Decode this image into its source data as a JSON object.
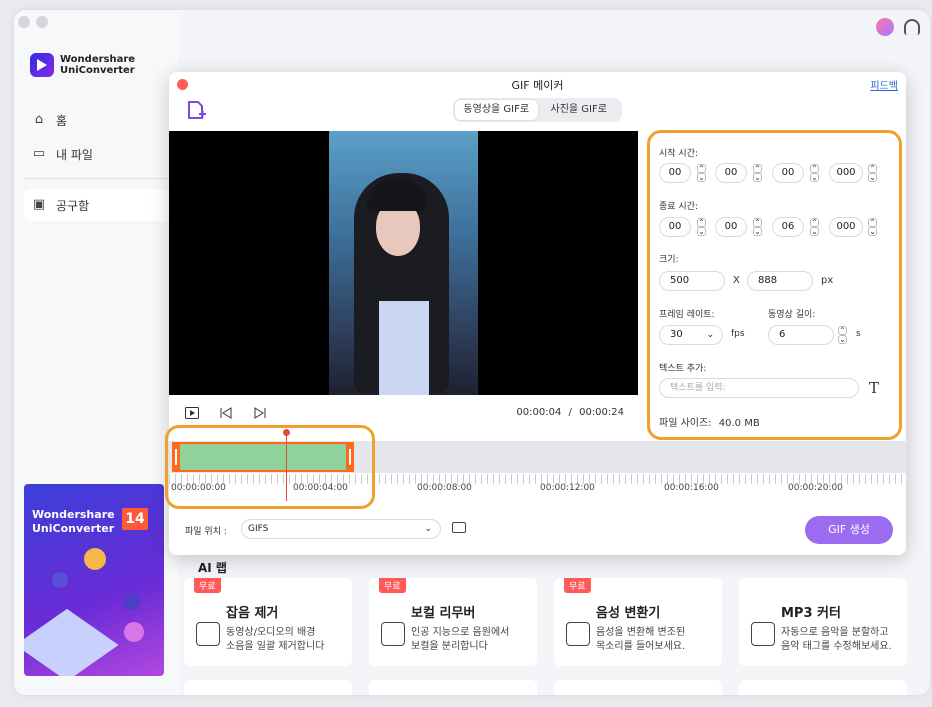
{
  "app": {
    "brand_line1": "Wondershare",
    "brand_line2": "UniConverter"
  },
  "sidebar": {
    "items": [
      {
        "label": "홈",
        "icon": "home-icon"
      },
      {
        "label": "내 파일",
        "icon": "folder-icon"
      },
      {
        "label": "공구함",
        "icon": "toolbox-icon"
      }
    ],
    "promo": {
      "title_line1": "Wondershare",
      "title_line2": "UniConverter",
      "badge": "14"
    }
  },
  "background": {
    "section_label": "AI 랩",
    "cards": [
      {
        "tag": "무료",
        "title": "잡음 제거",
        "desc1": "동영상/오디오의 배경",
        "desc2": "소음을 일괄 제거합니다"
      },
      {
        "tag": "무료",
        "title": "보컬 리무버",
        "desc1": "인공 지능으로 음원에서",
        "desc2": "보컬을 분리합니다"
      },
      {
        "tag": "무료",
        "title": "음성 변환기",
        "desc1": "음성을 변환해 변조된",
        "desc2": "목소리를 들어보세요."
      },
      {
        "tag": "",
        "title": "MP3 커터",
        "desc1": "자동으로 음악을 분할하고",
        "desc2": "음악 태그를 수정해보세요."
      }
    ]
  },
  "modal": {
    "title": "GIF 메이커",
    "feedback": "피드백",
    "tabs": [
      {
        "label": "동영상을 GIF로",
        "active": true
      },
      {
        "label": "사진을 GIF로",
        "active": false
      }
    ],
    "player": {
      "current": "00:00:04",
      "separator": "/",
      "total": "00:00:24"
    },
    "settings": {
      "start_label": "시작 시간:",
      "start": [
        "00",
        "00",
        "00",
        "000"
      ],
      "end_label": "종료 시간:",
      "end": [
        "00",
        "00",
        "06",
        "000"
      ],
      "size_label": "크기:",
      "width": "500",
      "x": "X",
      "height": "888",
      "px": "px",
      "framerate_label": "프레임 레이트:",
      "framerate": "30",
      "fps": "fps",
      "duration_label": "동영상 길이:",
      "duration": "6",
      "s": "s",
      "text_label": "텍스트 추가:",
      "text_placeholder": "텍스트를 입력:",
      "filesize_label": "파일 사이즈:",
      "filesize": "40.0 MB"
    },
    "timeline": {
      "ticks": [
        "00:00:00:00",
        "00:00:04:00",
        "00:00:08:00",
        "00:00:12:00",
        "00:00:16:00",
        "00:00:20:00"
      ]
    },
    "footer": {
      "location_label": "파일 위치 :",
      "location_value": "GIFS",
      "create_button": "GIF 생성"
    }
  },
  "colors": {
    "highlight": "#f0a02c",
    "accent": "#9b6cf0",
    "clip_border": "#ff6a1a",
    "clip_fill": "#8fd39a"
  }
}
